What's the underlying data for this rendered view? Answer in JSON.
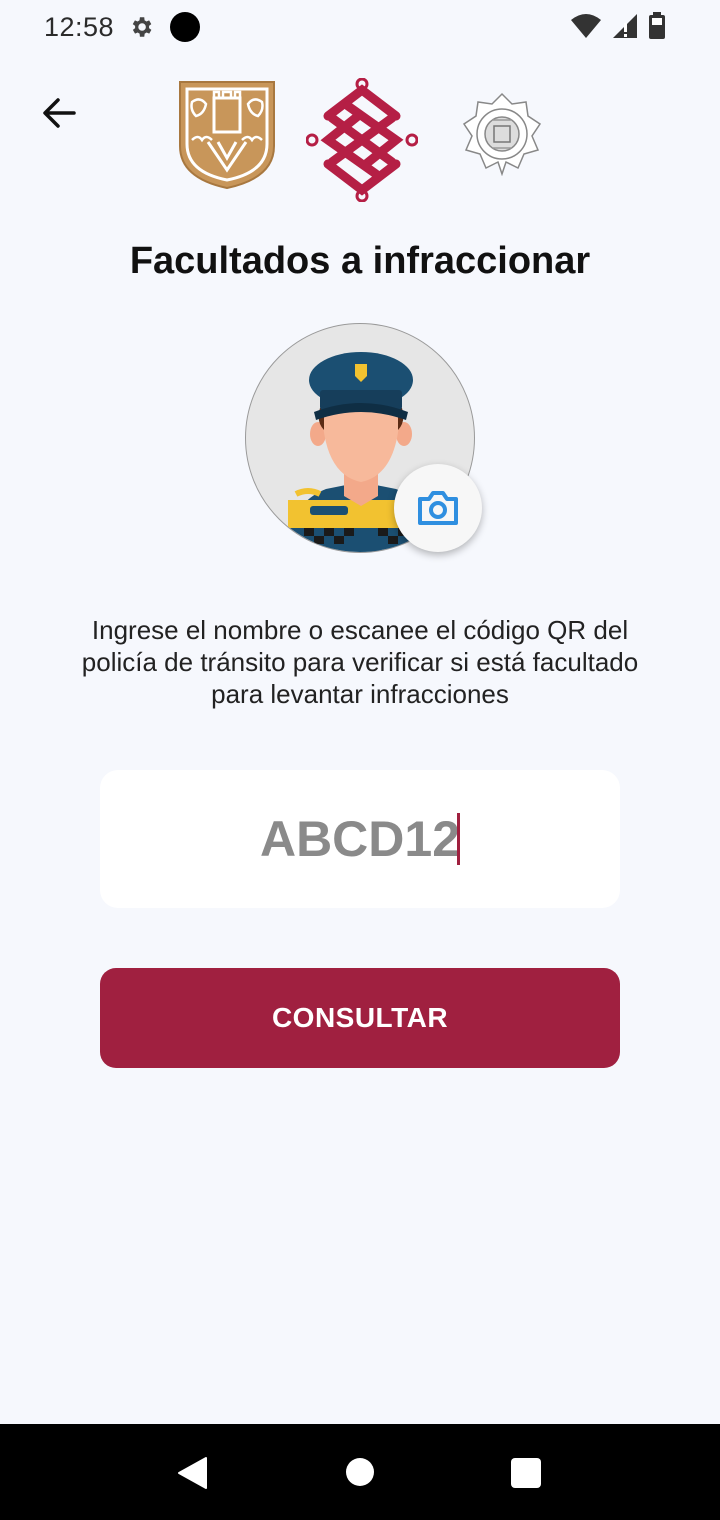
{
  "status_bar": {
    "time": "12:58",
    "icons": [
      "gear-icon",
      "notification-dot-icon",
      "wifi-icon",
      "signal-icon",
      "battery-icon"
    ]
  },
  "header": {
    "back_icon": "arrow-left-icon",
    "logos": [
      "cdmx-coat-of-arms",
      "cdmx-government-logo",
      "police-seal"
    ]
  },
  "main": {
    "title": "Facultados a infraccionar",
    "avatar_icon": "traffic-police-avatar",
    "camera_icon": "camera-icon",
    "instructions": "Ingrese el nombre o escanee el código QR del policía de tránsito para verificar si está facultado para levantar infracciones",
    "code_input": {
      "value": "ABCD12",
      "placeholder": ""
    },
    "consult_label": "CONSULTAR"
  },
  "nav_bar": {
    "icons": [
      "back-triangle-icon",
      "home-circle-icon",
      "recents-square-icon"
    ]
  },
  "colors": {
    "background": "#f6f8fd",
    "primary": "#a02040",
    "shield_gold": "#c8965a",
    "camera_blue": "#2f8fe0"
  }
}
